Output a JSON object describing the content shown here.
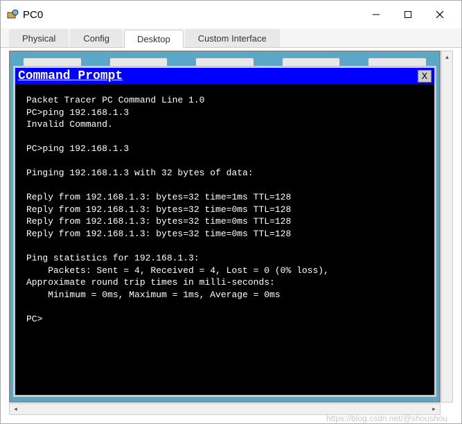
{
  "window": {
    "title": "PC0"
  },
  "tabs": [
    {
      "label": "Physical",
      "active": false
    },
    {
      "label": "Config",
      "active": false
    },
    {
      "label": "Desktop",
      "active": true
    },
    {
      "label": "Custom Interface",
      "active": false
    }
  ],
  "cmd": {
    "title": "Command Prompt",
    "close_label": "X",
    "lines": [
      "Packet Tracer PC Command Line 1.0",
      "PC>ping 192.168.1.3",
      "Invalid Command.",
      "",
      "PC>ping 192.168.1.3",
      "",
      "Pinging 192.168.1.3 with 32 bytes of data:",
      "",
      "Reply from 192.168.1.3: bytes=32 time=1ms TTL=128",
      "Reply from 192.168.1.3: bytes=32 time=0ms TTL=128",
      "Reply from 192.168.1.3: bytes=32 time=0ms TTL=128",
      "Reply from 192.168.1.3: bytes=32 time=0ms TTL=128",
      "",
      "Ping statistics for 192.168.1.3:",
      "    Packets: Sent = 4, Received = 4, Lost = 0 (0% loss),",
      "Approximate round trip times in milli-seconds:",
      "    Minimum = 0ms, Maximum = 1ms, Average = 0ms",
      "",
      "PC>"
    ]
  },
  "watermark": "https://blog.csdn.net/@shoushou"
}
